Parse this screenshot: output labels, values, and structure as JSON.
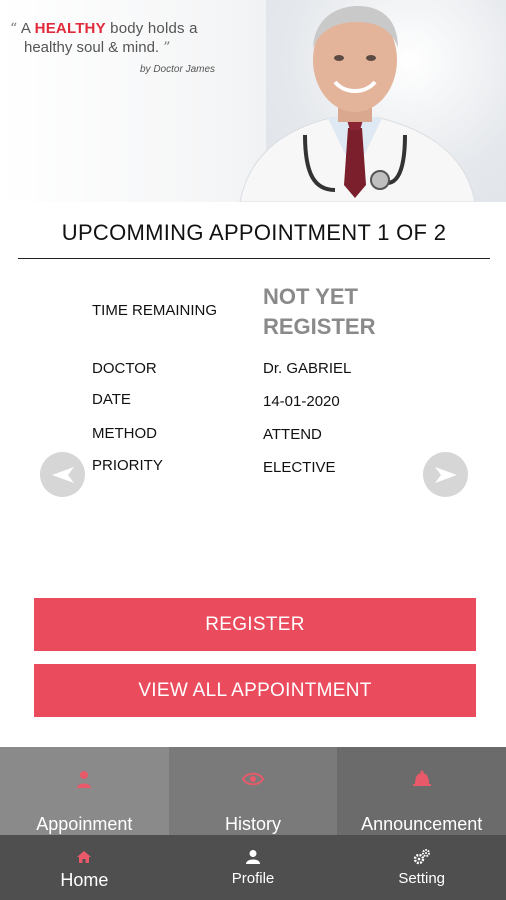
{
  "banner": {
    "quote_prefix": "A",
    "quote_highlight": "HEALTHY",
    "quote_rest_line1": "body holds a",
    "quote_line2": "healthy soul & mind.",
    "open_quote": "“",
    "close_quote": "”",
    "attribution": "by Doctor James"
  },
  "appointment": {
    "heading": "UPCOMMING APPOINTMENT 1 OF 2",
    "time_remaining_label": "TIME REMAINING",
    "status_line1": "NOT YET",
    "status_line2": "REGISTER",
    "doctor_label": "DOCTOR",
    "doctor_value": "Dr. GABRIEL",
    "date_label": "DATE",
    "date_value": "14-01-2020",
    "method_label": "METHOD",
    "method_value": "ATTEND",
    "priority_label": "PRIORITY",
    "priority_value": "ELECTIVE"
  },
  "actions": {
    "register_label": "REGISTER",
    "view_all_label": "VIEW ALL APPOINTMENT"
  },
  "tabs": [
    {
      "label": "Appoinment",
      "icon": "person-icon"
    },
    {
      "label": "History",
      "icon": "eye-icon"
    },
    {
      "label": "Announcement",
      "icon": "bell-icon"
    }
  ],
  "nav": [
    {
      "label": "Home",
      "icon": "home-icon"
    },
    {
      "label": "Profile",
      "icon": "user-icon"
    },
    {
      "label": "Setting",
      "icon": "gear-icon"
    }
  ],
  "colors": {
    "accent": "#ea4c5e",
    "highlight": "#e12b3b",
    "tab_icon": "#e8596a",
    "nav_bg": "#4f4f4f"
  }
}
